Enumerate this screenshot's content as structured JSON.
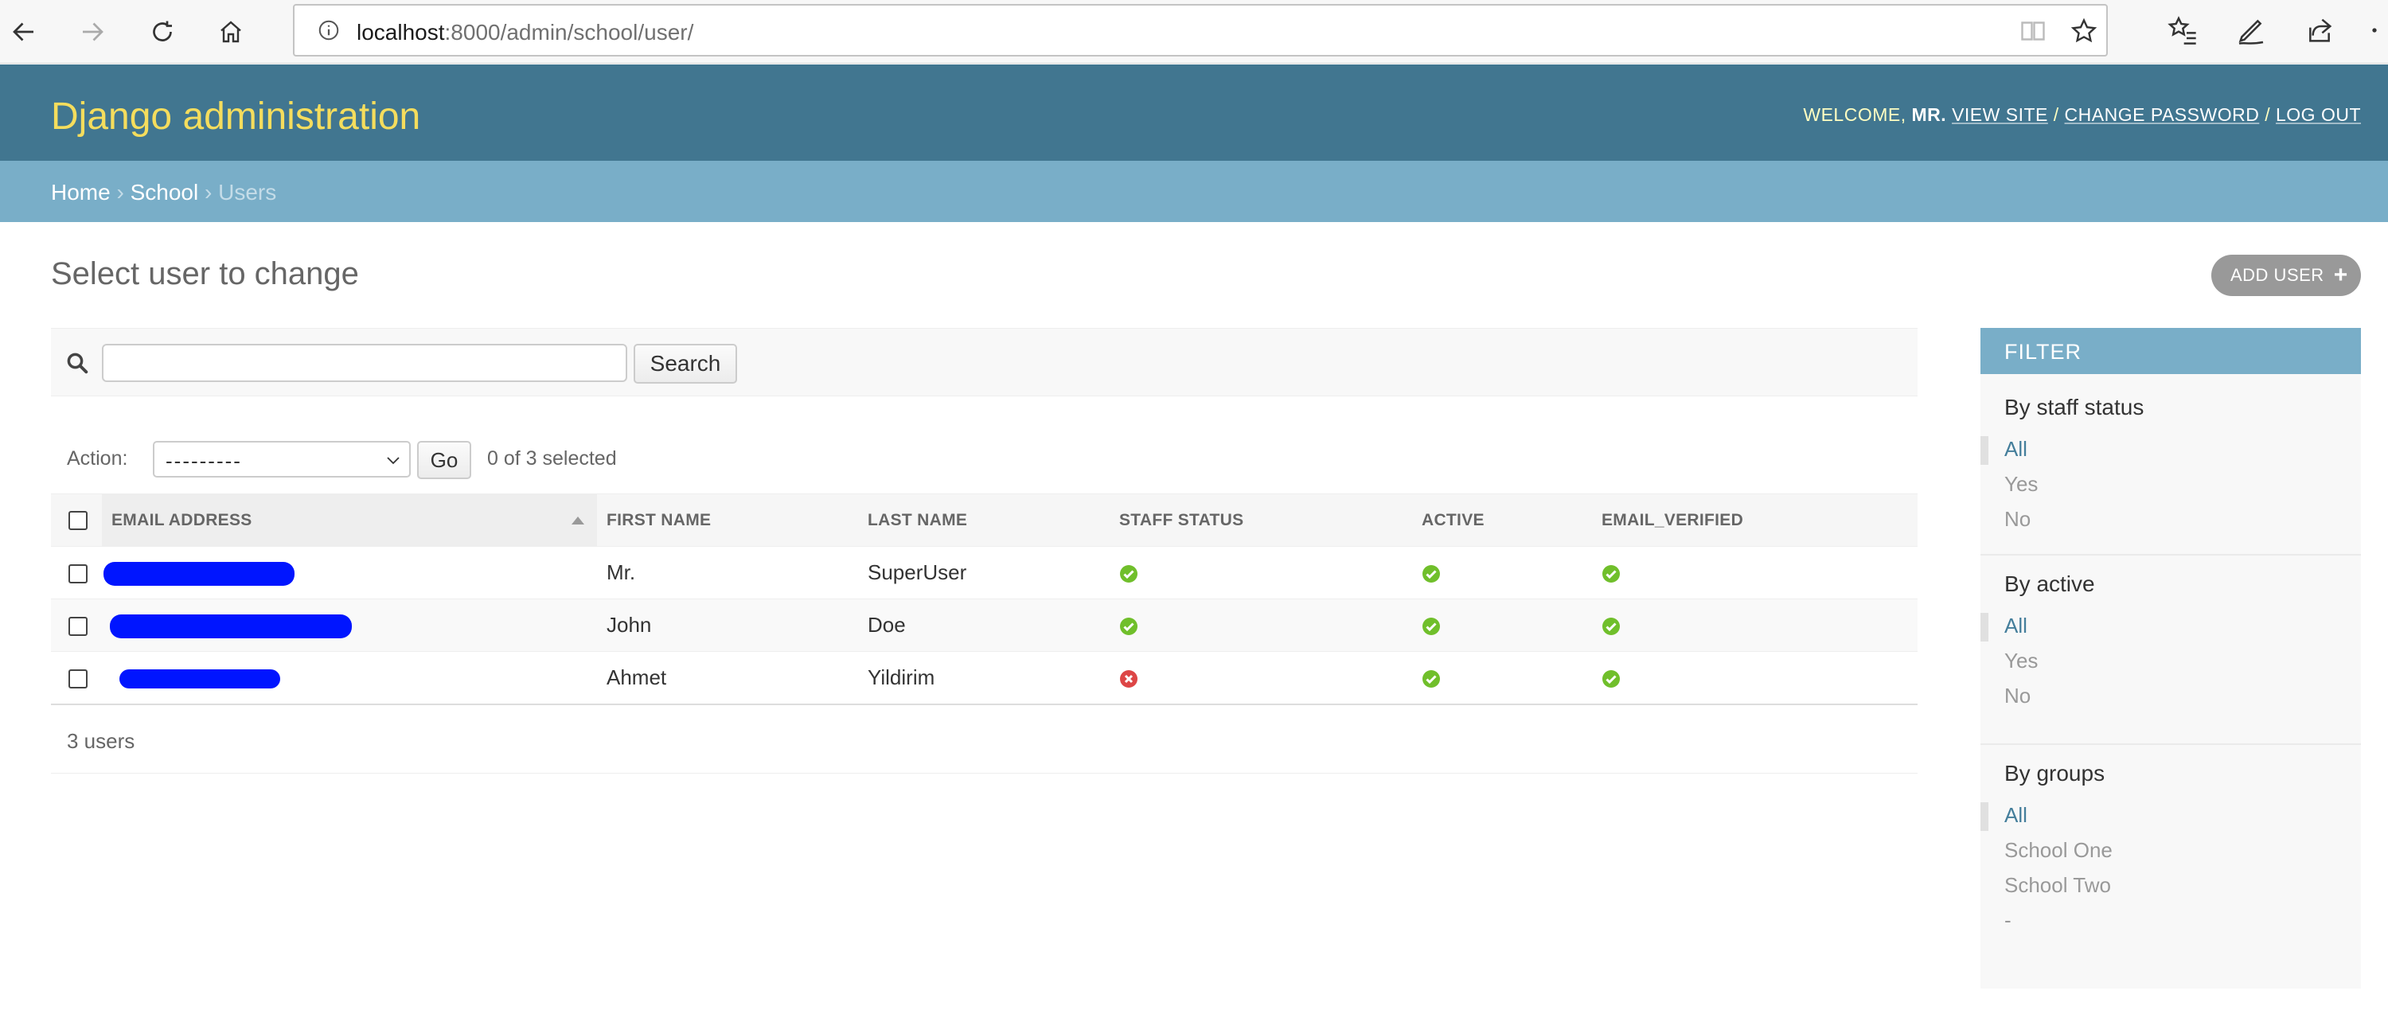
{
  "browser": {
    "url_host": "localhost",
    "url_path": ":8000/admin/school/user/"
  },
  "header": {
    "brand": "Django administration",
    "welcome": "WELCOME,",
    "user": "MR.",
    "view_site": "VIEW SITE",
    "change_password": "CHANGE PASSWORD",
    "log_out": "LOG OUT",
    "separator": "/"
  },
  "breadcrumbs": {
    "home": "Home",
    "app": "School",
    "current": "Users",
    "sep": "›"
  },
  "page": {
    "title": "Select user to change",
    "add_button": "ADD USER",
    "add_symbol": "+"
  },
  "search": {
    "value": "",
    "button": "Search"
  },
  "actions": {
    "label": "Action:",
    "selected_option": "---------",
    "go": "Go",
    "count": "0 of 3 selected"
  },
  "table": {
    "columns": [
      "EMAIL ADDRESS",
      "FIRST NAME",
      "LAST NAME",
      "STAFF STATUS",
      "ACTIVE",
      "EMAIL_VERIFIED"
    ],
    "rows": [
      {
        "first_name": "Mr.",
        "last_name": "SuperUser",
        "staff": true,
        "active": true,
        "verified": true
      },
      {
        "first_name": "John",
        "last_name": "Doe",
        "staff": true,
        "active": true,
        "verified": true
      },
      {
        "first_name": "Ahmet",
        "last_name": "Yildirim",
        "staff": false,
        "active": true,
        "verified": true
      }
    ]
  },
  "paginator": "3 users",
  "filter": {
    "title": "FILTER",
    "sections": [
      {
        "title": "By staff status",
        "items": [
          "All",
          "Yes",
          "No"
        ]
      },
      {
        "title": "By active",
        "items": [
          "All",
          "Yes",
          "No"
        ]
      },
      {
        "title": "By groups",
        "items": [
          "All",
          "School One",
          "School Two",
          "-"
        ]
      }
    ]
  },
  "colors": {
    "header_bg": "#417690",
    "brand": "#f5dd5d",
    "breadcrumb_bg": "#79aec8",
    "ok": "#70bf2b",
    "no": "#dd4646",
    "redaction": "#0015ff"
  }
}
